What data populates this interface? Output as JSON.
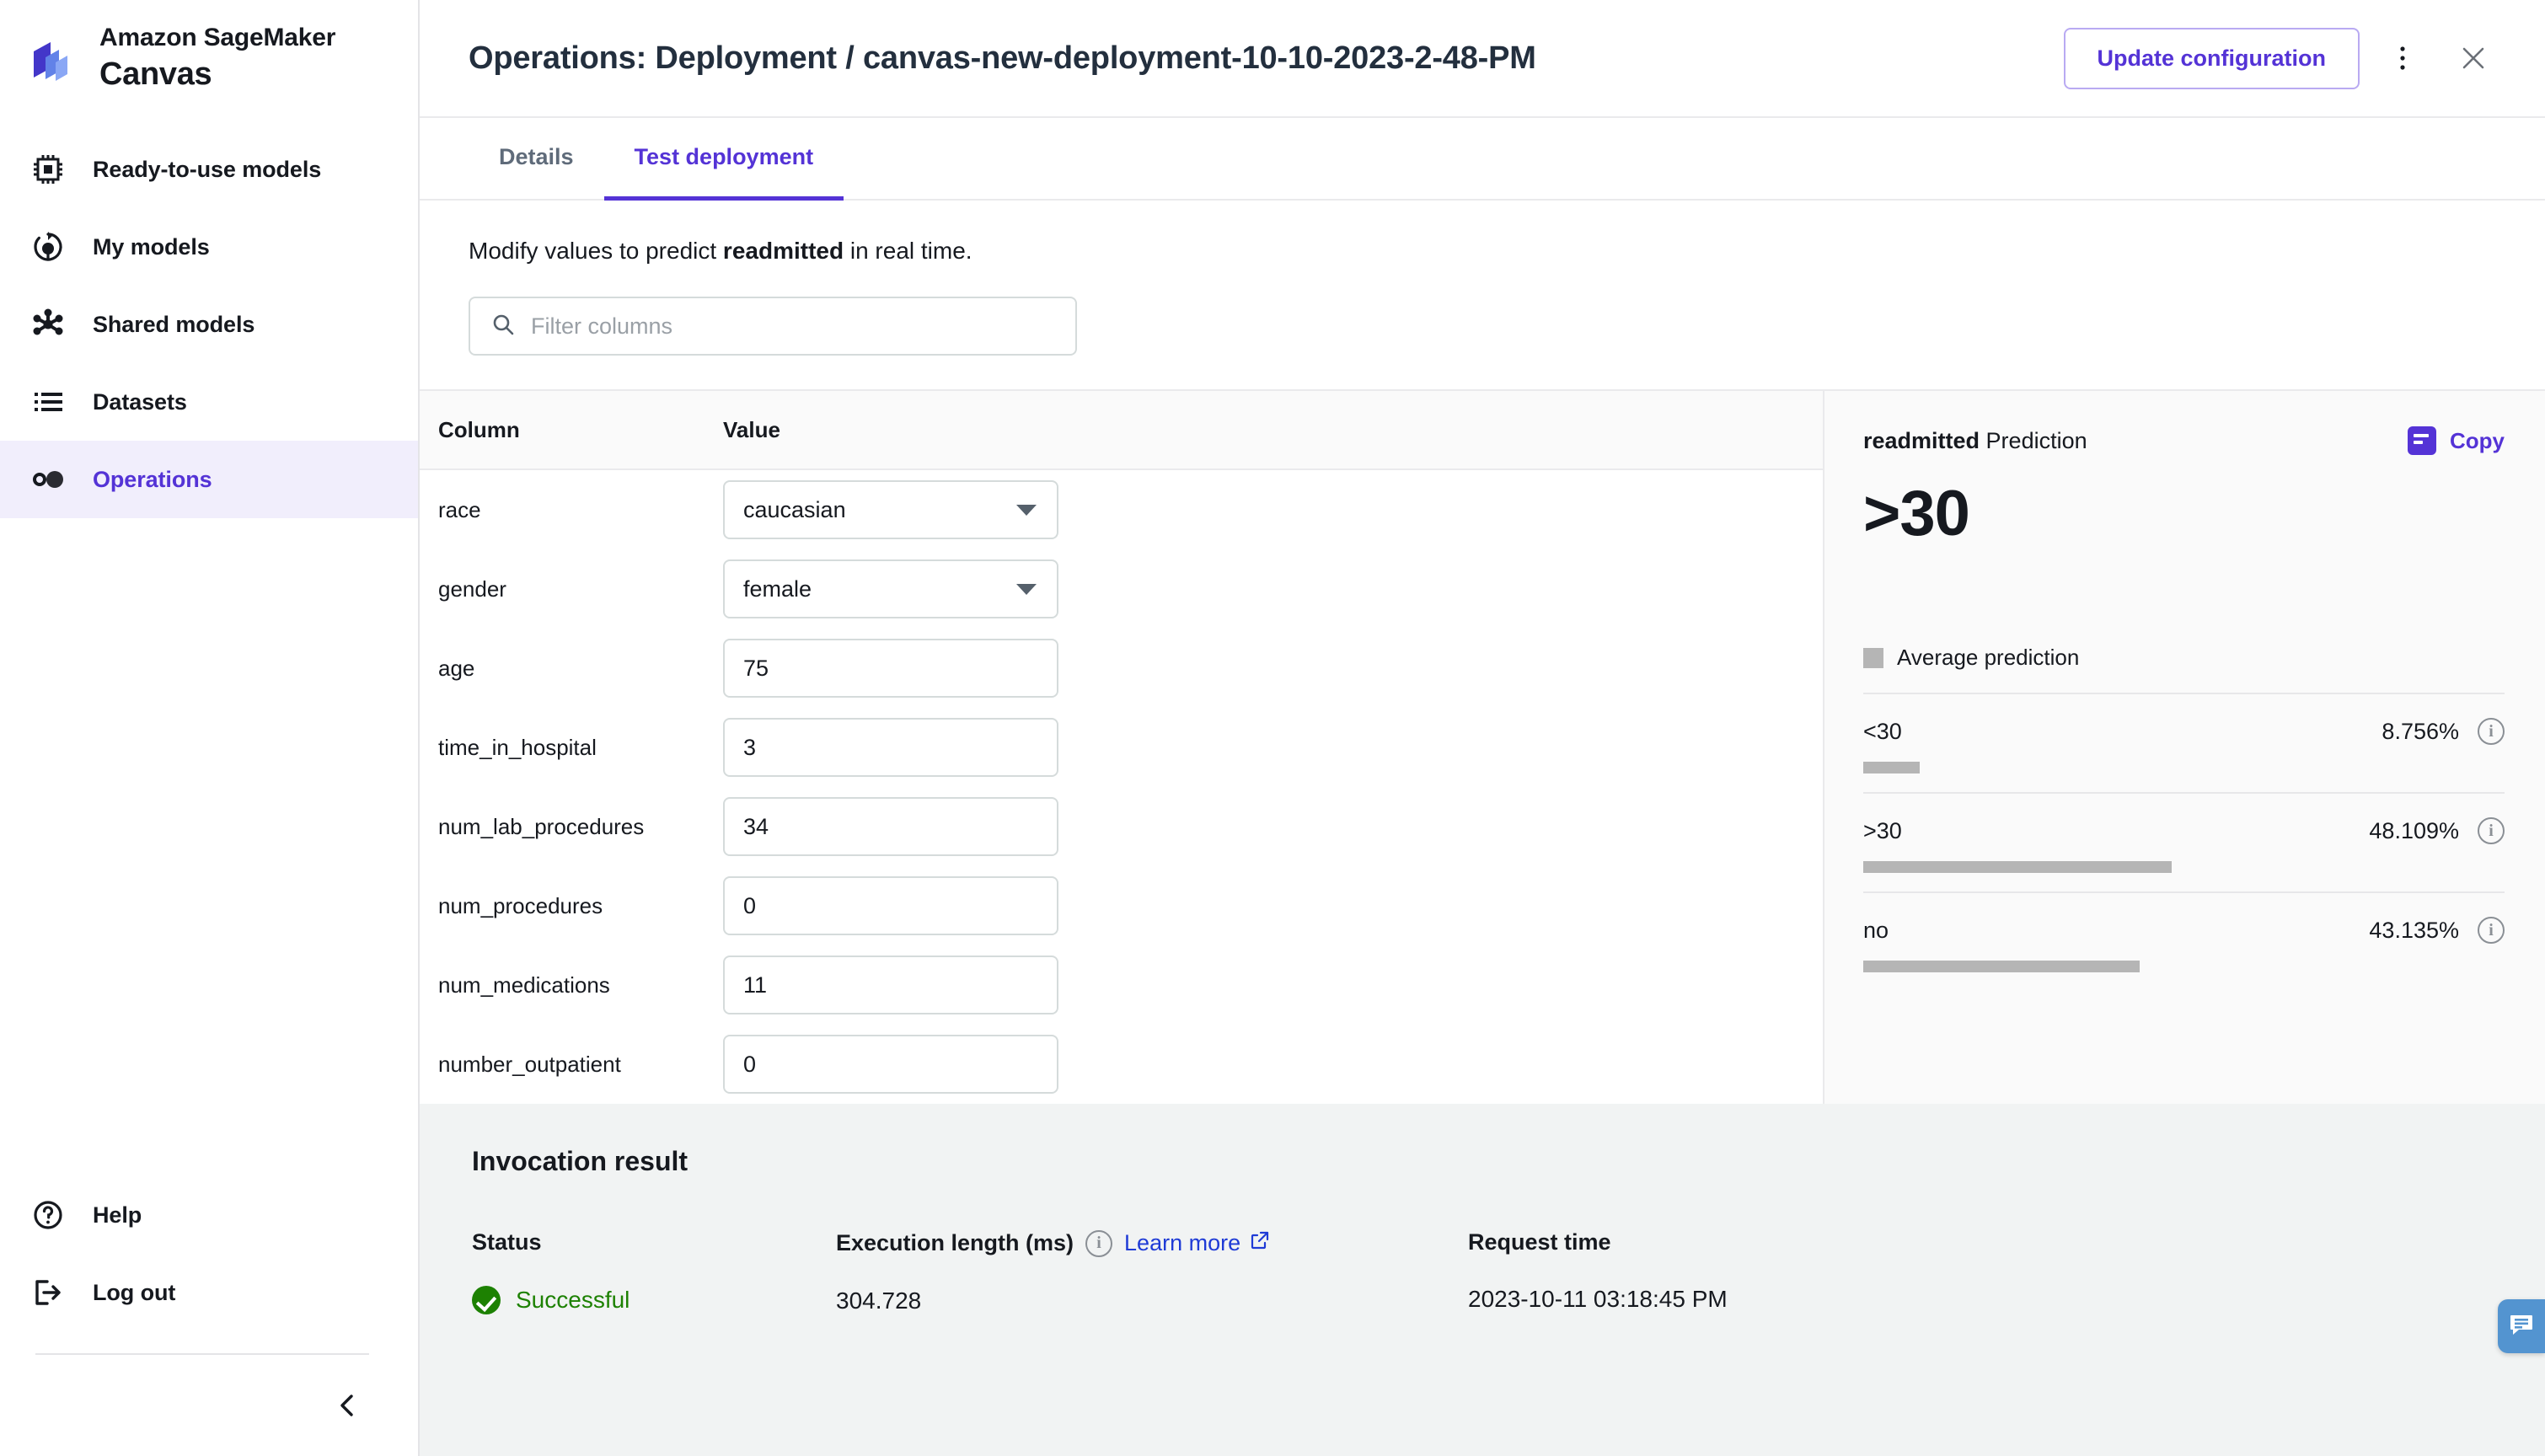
{
  "sidebar": {
    "brand": {
      "line1": "Amazon SageMaker",
      "line2": "Canvas",
      "logo_icon": "sagemaker-logo-icon"
    },
    "items": [
      {
        "label": "Ready-to-use models",
        "icon": "chip-icon",
        "active": false
      },
      {
        "label": "My models",
        "icon": "model-refresh-icon",
        "active": false
      },
      {
        "label": "Shared models",
        "icon": "share-nodes-icon",
        "active": false
      },
      {
        "label": "Datasets",
        "icon": "list-icon",
        "active": false
      },
      {
        "label": "Operations",
        "icon": "operations-circles-icon",
        "active": true
      }
    ],
    "bottom_items": [
      {
        "label": "Help",
        "icon": "question-circle-icon"
      },
      {
        "label": "Log out",
        "icon": "logout-icon"
      }
    ],
    "collapse_icon": "chevron-left-icon"
  },
  "header": {
    "title_prefix": "Operations: Deployment / ",
    "title_name": "canvas-new-deployment-10-10-2023-2-48-PM",
    "update_button": "Update configuration",
    "overflow_icon": "kebab-menu-icon",
    "close_icon": "close-icon"
  },
  "tabs": [
    {
      "label": "Details",
      "active": false
    },
    {
      "label": "Test deployment",
      "active": true
    }
  ],
  "instructions": {
    "prefix": "Modify values to predict ",
    "target": "readmitted",
    "suffix": " in real time."
  },
  "filter": {
    "placeholder": "Filter columns",
    "value": "",
    "icon": "search-icon"
  },
  "table": {
    "headers": {
      "column": "Column",
      "value": "Value"
    },
    "rows": [
      {
        "column": "race",
        "value": "caucasian",
        "type": "select"
      },
      {
        "column": "gender",
        "value": "female",
        "type": "select"
      },
      {
        "column": "age",
        "value": "75",
        "type": "text"
      },
      {
        "column": "time_in_hospital",
        "value": "3",
        "type": "text"
      },
      {
        "column": "num_lab_procedures",
        "value": "34",
        "type": "text"
      },
      {
        "column": "num_procedures",
        "value": "0",
        "type": "text"
      },
      {
        "column": "num_medications",
        "value": "11",
        "type": "text"
      },
      {
        "column": "number_outpatient",
        "value": "0",
        "type": "text"
      }
    ]
  },
  "prediction": {
    "title_target": "readmitted",
    "title_suffix": " Prediction",
    "copy_label": "Copy",
    "copy_icon": "copy-icon",
    "value": ">30",
    "legend_label": "Average prediction",
    "legend_color": "#b5b5b5",
    "rows": [
      {
        "label": "<30",
        "percent": "8.756%",
        "bar_pct": 8.756,
        "info_icon": "info-icon"
      },
      {
        "label": ">30",
        "percent": "48.109%",
        "bar_pct": 48.109,
        "info_icon": "info-icon"
      },
      {
        "label": "no",
        "percent": "43.135%",
        "bar_pct": 43.135,
        "info_icon": "info-icon"
      }
    ]
  },
  "invocation": {
    "title": "Invocation result",
    "status_header": "Status",
    "status_value": "Successful",
    "status_icon": "check-circle-icon",
    "exec_header": "Execution length (ms)",
    "exec_info_icon": "info-icon",
    "learn_more": "Learn more",
    "learn_more_icon": "external-link-icon",
    "exec_value": "304.728",
    "request_header": "Request time",
    "request_value": "2023-10-11 03:18:45 PM"
  },
  "feedback": {
    "icon": "chat-feedback-icon"
  },
  "colors": {
    "accent": "#5433d6",
    "link": "#1f3bd6",
    "success": "#1d8102",
    "bar": "#b5b5b5",
    "panel_bg": "#fafafa",
    "footer_bg": "#f1f3f3",
    "feedback": "#5394d0"
  }
}
